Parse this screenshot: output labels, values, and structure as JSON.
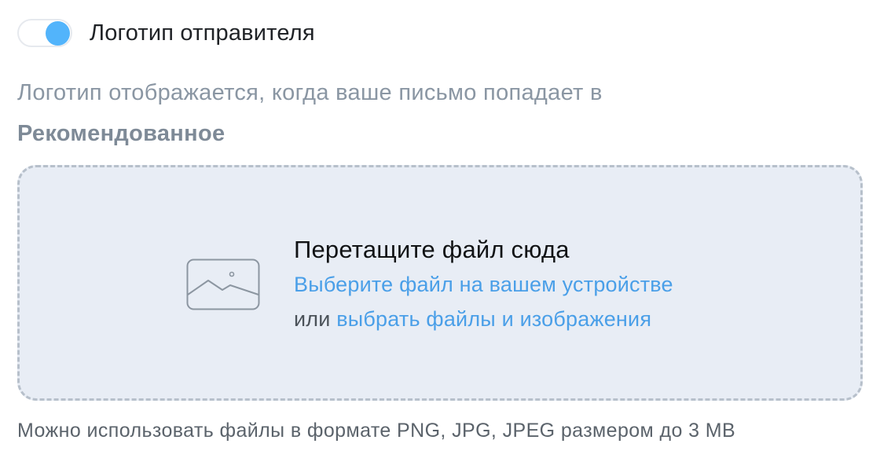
{
  "toggle": {
    "label": "Логотип отправителя",
    "on": true,
    "accent": "#52b4fb"
  },
  "description": {
    "text": "Логотип отображается, когда ваше письмо попадает в",
    "bold": "Рекомендованное"
  },
  "dropzone": {
    "icon": "image-icon",
    "title": "Перетащите файл сюда",
    "choose_device_link": "Выберите файл на вашем устройстве",
    "or_text": "или",
    "choose_media_link": "выбрать файлы и изображения"
  },
  "hint": "Можно использовать файлы в формате PNG, JPG, JPEG размером до 3 MB"
}
